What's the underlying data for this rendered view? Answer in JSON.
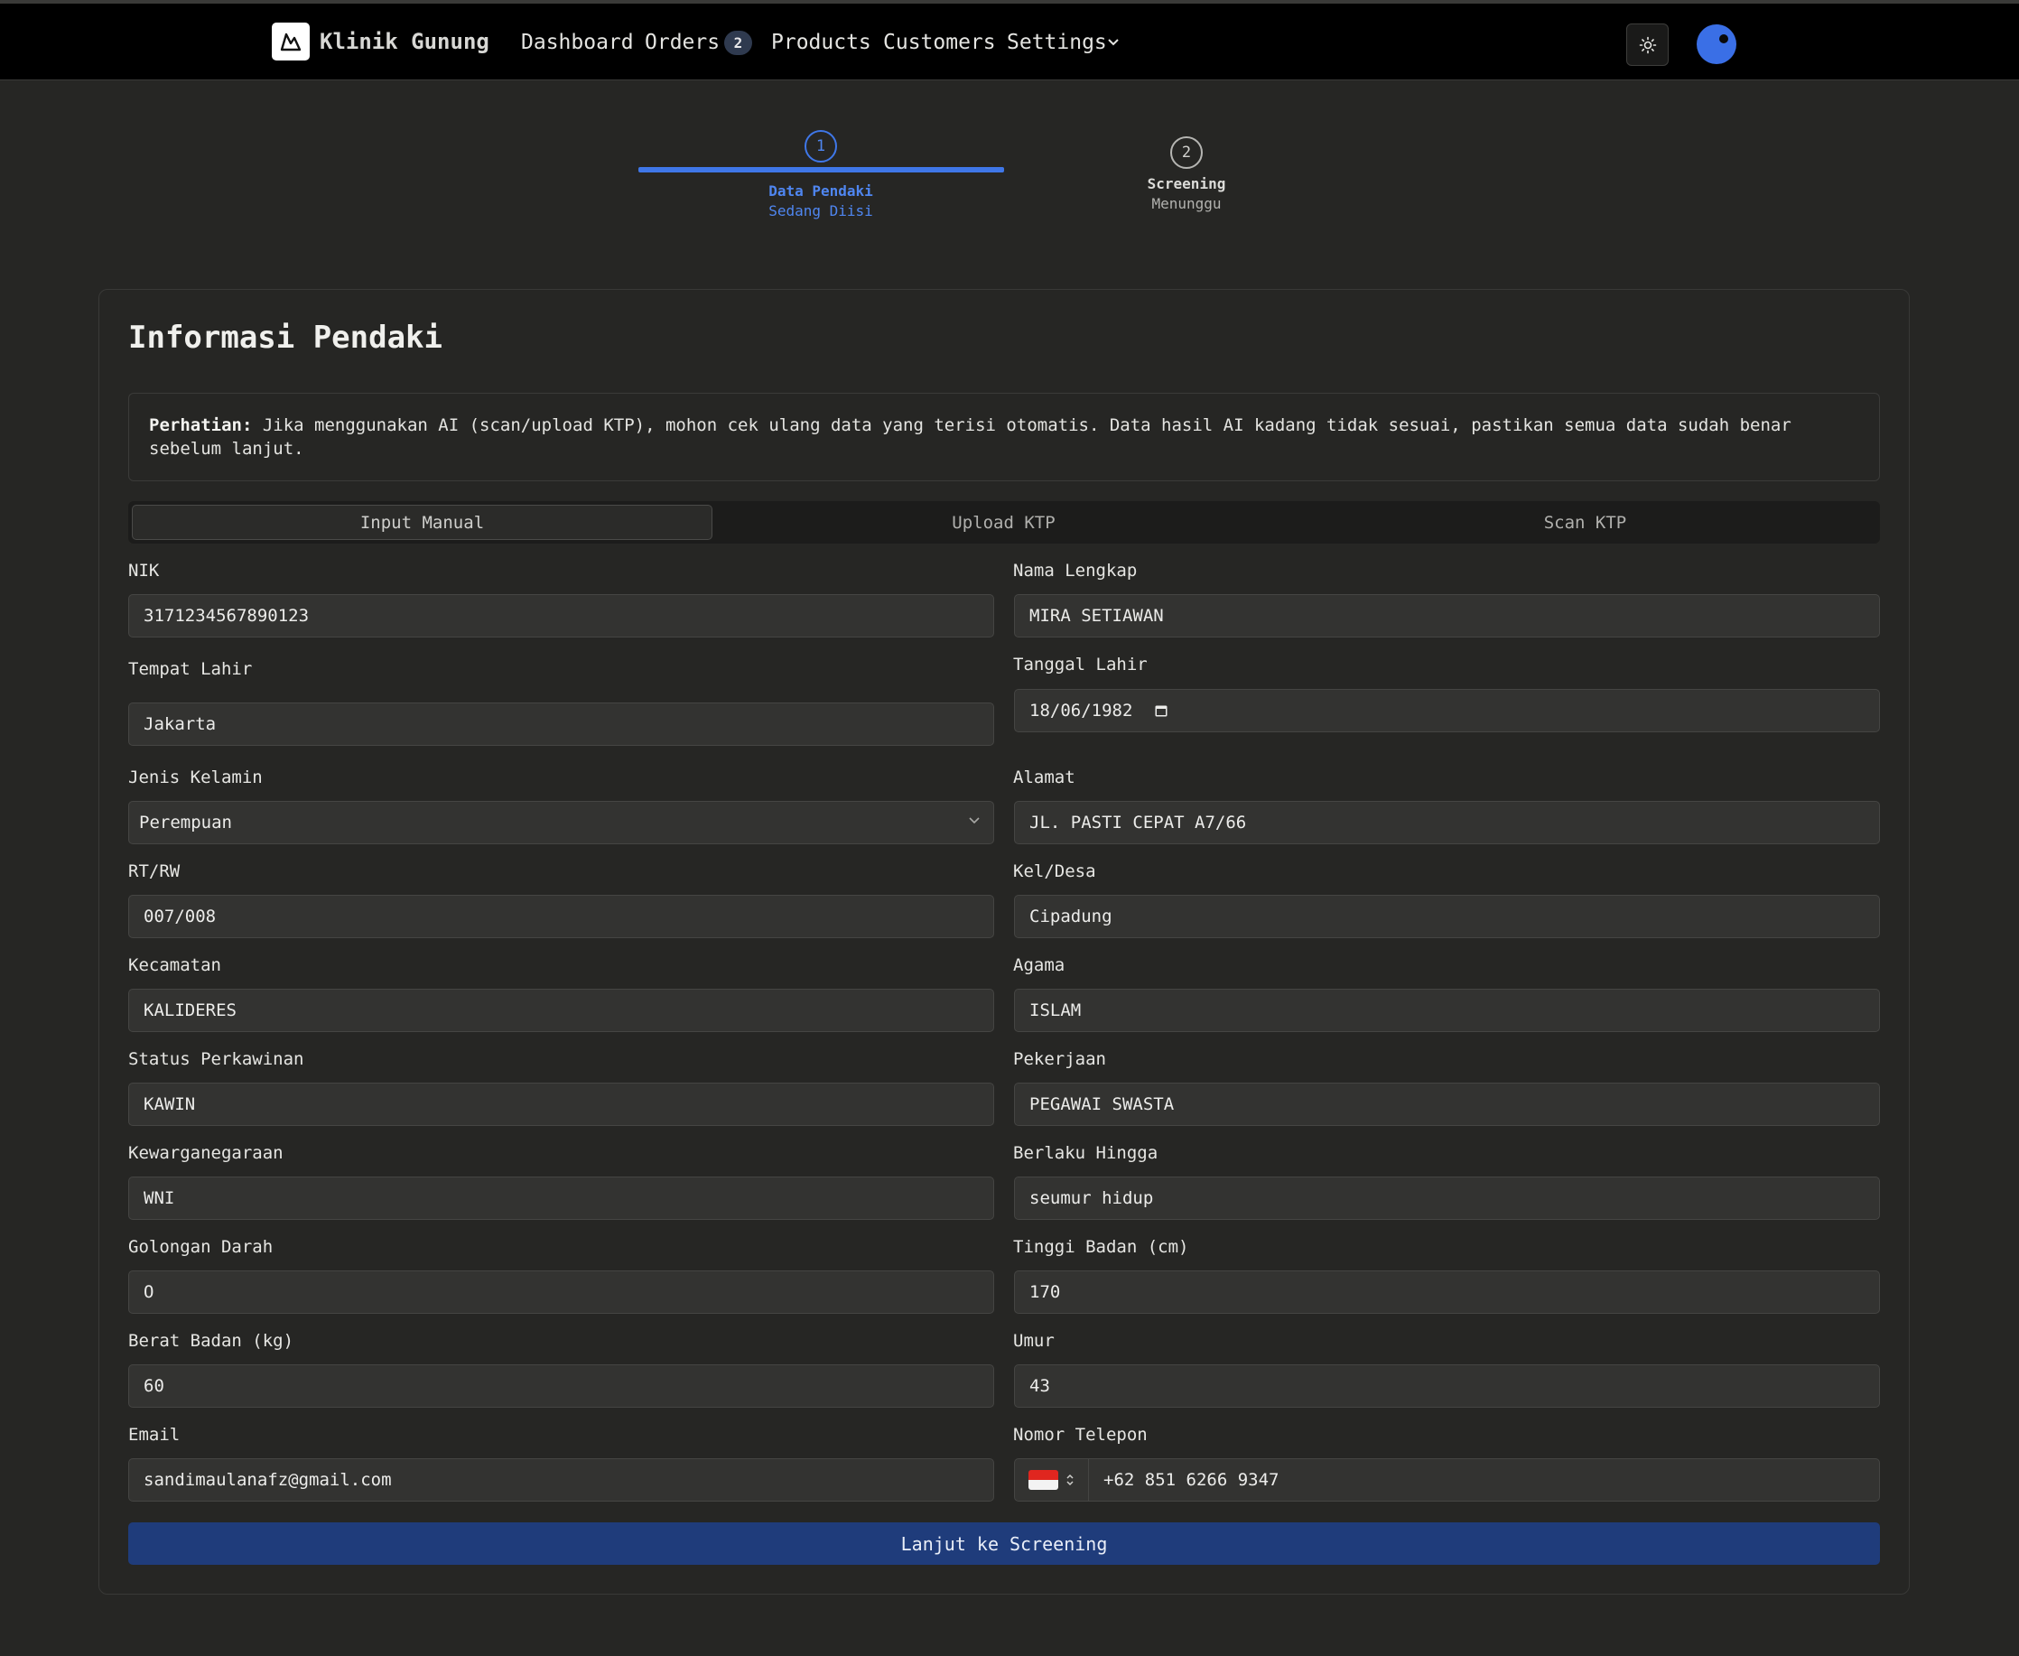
{
  "nav": {
    "brand": "Klinik Gunung",
    "items": [
      "Dashboard",
      "Orders",
      "Products",
      "Customers",
      "Settings"
    ],
    "orders_badge": "2"
  },
  "stepper": {
    "steps": [
      {
        "number": "1",
        "title": "Data Pendaki",
        "status": "Sedang Diisi"
      },
      {
        "number": "2",
        "title": "Screening",
        "status": "Menunggu"
      }
    ]
  },
  "card": {
    "title": "Informasi Pendaki",
    "notice_bold": "Perhatian:",
    "notice_text": " Jika menggunakan AI (scan/upload KTP), mohon cek ulang data yang terisi otomatis. Data hasil AI kadang tidak sesuai, pastikan semua data sudah benar sebelum lanjut.",
    "tabs": [
      "Input Manual",
      "Upload KTP",
      "Scan KTP"
    ]
  },
  "form": {
    "nik": {
      "label": "NIK",
      "value": "3171234567890123"
    },
    "nama": {
      "label": "Nama Lengkap",
      "value": "MIRA SETIAWAN"
    },
    "tempat_lahir": {
      "label": "Tempat Lahir",
      "value": "Jakarta"
    },
    "tanggal_lahir": {
      "label": "Tanggal Lahir",
      "value": "18/06/1982"
    },
    "jenis_kelamin": {
      "label": "Jenis Kelamin",
      "value": "Perempuan"
    },
    "alamat": {
      "label": "Alamat",
      "value": "JL. PASTI CEPAT A7/66"
    },
    "rt_rw": {
      "label": "RT/RW",
      "value": "007/008"
    },
    "kel_desa": {
      "label": "Kel/Desa",
      "value": "Cipadung"
    },
    "kecamatan": {
      "label": "Kecamatan",
      "value": "KALIDERES"
    },
    "agama": {
      "label": "Agama",
      "value": "ISLAM"
    },
    "status_perkawinan": {
      "label": "Status Perkawinan",
      "value": "KAWIN"
    },
    "pekerjaan": {
      "label": "Pekerjaan",
      "value": "PEGAWAI SWASTA"
    },
    "kewarganegaraan": {
      "label": "Kewarganegaraan",
      "value": "WNI"
    },
    "berlaku_hingga": {
      "label": "Berlaku Hingga",
      "value": "seumur hidup"
    },
    "golongan_darah": {
      "label": "Golongan Darah",
      "value": "O"
    },
    "tinggi_badan": {
      "label": "Tinggi Badan (cm)",
      "value": "170"
    },
    "berat_badan": {
      "label": "Berat Badan (kg)",
      "value": "60"
    },
    "umur": {
      "label": "Umur",
      "value": "43"
    },
    "email": {
      "label": "Email",
      "value": "sandimaulanafz@gmail.com"
    },
    "telepon": {
      "label": "Nomor Telepon",
      "value": "+62 851 6266 9347"
    }
  },
  "submit_label": "Lanjut ke Screening",
  "colors": {
    "accent": "#3f77e8",
    "submit": "#1f3c7b",
    "background": "#262624",
    "navbar": "#000000"
  }
}
